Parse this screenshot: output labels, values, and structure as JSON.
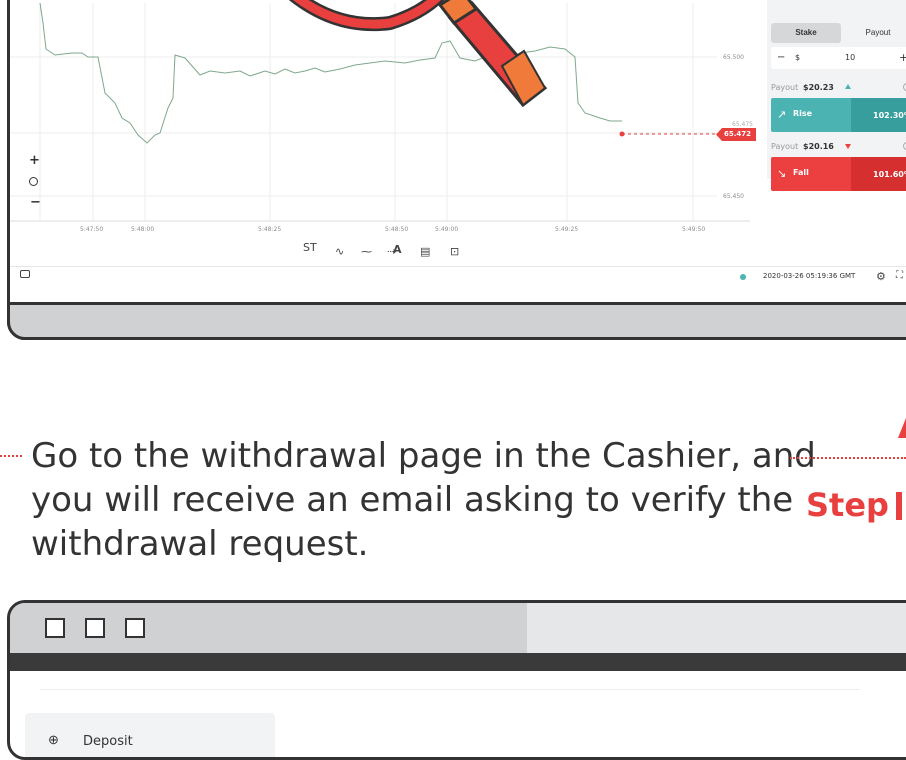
{
  "chart": {
    "x_ticks": [
      "5:47:50",
      "5:48:00",
      "5:48:25",
      "5:48:50",
      "5:49:00",
      "5:49:25",
      "5:49:50"
    ],
    "y_ticks": [
      "65.500",
      "65.450"
    ],
    "y_partial_label": "65.475",
    "current_price": "65.472",
    "zoom_in": "+",
    "zoom_out": "−",
    "tools": [
      "ST",
      "∿",
      "⁓",
      "⇢",
      "A",
      "▤",
      "⊡"
    ]
  },
  "trade_panel": {
    "tabs": [
      "Stake",
      "Payout"
    ],
    "currency_symbol": "$",
    "minus_label": "−",
    "plus_label": "+",
    "stake_value": "10",
    "rise": {
      "payout_label": "Payout",
      "payout_value": "$20.23",
      "button_label": "Rise",
      "percent": "102.30%",
      "color": "#4bb4b3"
    },
    "fall": {
      "payout_label": "Payout",
      "payout_value": "$20.16",
      "button_label": "Fall",
      "percent": "101.60%",
      "color": "#ec3f3f"
    }
  },
  "footer": {
    "timestamp": "2020-03-26 05:19:36 GMT"
  },
  "instruction": {
    "line1": "Go to the withdrawal page in the Cashier, and",
    "line2": "you will receive an email asking to verify the",
    "line3": "withdrawal request."
  },
  "step_label": "Step",
  "cashier": {
    "menu": [
      {
        "label": "Deposit",
        "icon": "deposit-icon"
      }
    ]
  },
  "colors": {
    "accent_red": "#e8403e",
    "rise_green": "#4bb4b3",
    "fall_red": "#ec3f3f",
    "frame": "#333333"
  }
}
